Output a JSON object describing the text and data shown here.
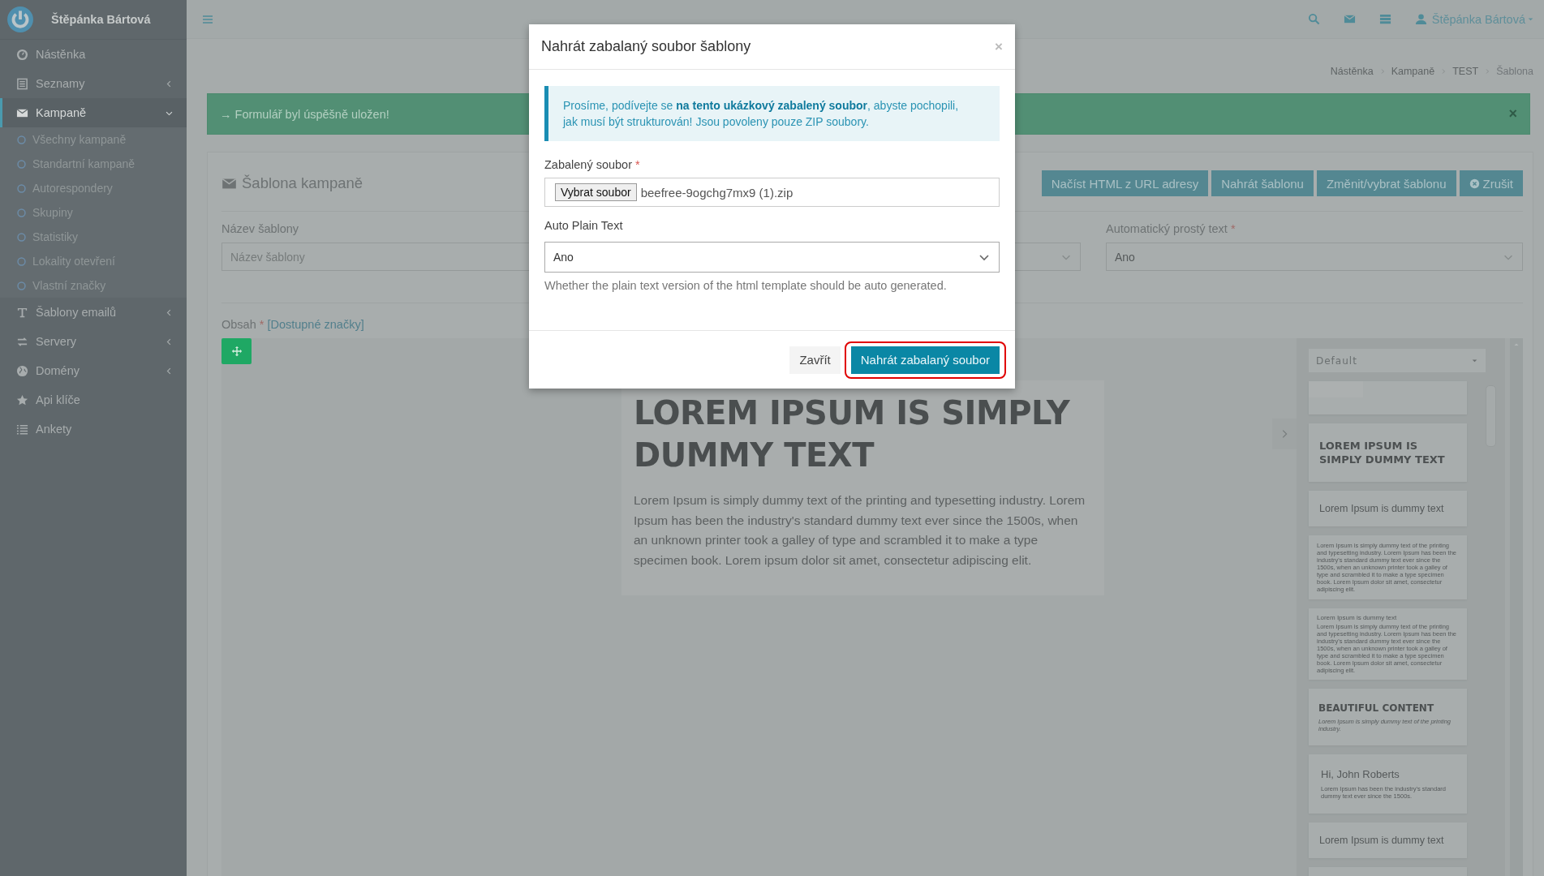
{
  "brand": {
    "name": "Štěpánka Bártová"
  },
  "sidebar": {
    "items": [
      {
        "label": "Nástěnka",
        "selected": false
      },
      {
        "label": "Seznamy",
        "expanded": false,
        "selected": false
      },
      {
        "label": "Kampaně",
        "expanded": true,
        "selected": true,
        "children": [
          {
            "label": "Všechny kampaně"
          },
          {
            "label": "Standartní kampaně"
          },
          {
            "label": "Autorespondery"
          },
          {
            "label": "Skupiny"
          },
          {
            "label": "Statistiky"
          },
          {
            "label": "Lokality otevření"
          },
          {
            "label": "Vlastní značky"
          }
        ]
      },
      {
        "label": "Šablony emailů",
        "expanded": false,
        "selected": false
      },
      {
        "label": "Servery",
        "expanded": false,
        "selected": false
      },
      {
        "label": "Domény",
        "expanded": false,
        "selected": false
      },
      {
        "label": "Api klíče",
        "selected": false
      },
      {
        "label": "Ankety",
        "selected": false
      }
    ]
  },
  "topbar": {
    "user": "Štěpánka Bártová"
  },
  "breadcrumb": [
    {
      "label": "Nástěnka",
      "current": false
    },
    {
      "label": "Kampaně",
      "current": false
    },
    {
      "label": "TEST",
      "current": false
    },
    {
      "label": "Šablona",
      "current": true
    }
  ],
  "alert": {
    "text": "→ Formulář byl úspěšně uložen!",
    "close": "×"
  },
  "card": {
    "title": "Šablona kampaně",
    "buttons": [
      {
        "label": "Načíst HTML z URL adresy",
        "kind": "action"
      },
      {
        "label": "Nahrát šablonu",
        "kind": "action"
      },
      {
        "label": "Změnit/vybrat šablonu",
        "kind": "action"
      },
      {
        "label": "Zrušit",
        "kind": "cancel"
      }
    ],
    "fields": [
      {
        "kind": "input",
        "label": "Název šablony",
        "placeholder": "Název šablony"
      },
      {
        "kind": "select"
      },
      {
        "kind": "select",
        "label": "Automatický prostý text",
        "required_mark": "*",
        "value": "Ano"
      }
    ],
    "content": {
      "label": "Obsah",
      "required_mark": "*",
      "link": "[Dostupné značky]"
    },
    "editor": {
      "heading": "LOREM IPSUM IS SIMPLY DUMMY TEXT",
      "paragraph": "Lorem Ipsum is simply dummy text of the printing and typesetting industry. Lorem Ipsum has been the industry's standard dummy text ever since the 1500s, when an unknown printer took a galley of type and scrambled it to make a type specimen book. Lorem ipsum dolor sit amet, consectetur adipiscing elit.",
      "panel": {
        "dropdown": "Default",
        "blocks": [
          {
            "kind": "image"
          },
          {
            "kind": "heading",
            "title": "LOREM IPSUM IS SIMPLY DUMMY TEXT"
          },
          {
            "kind": "subtitle",
            "title": "Lorem Ipsum is dummy text"
          },
          {
            "kind": "paragraph",
            "text": "Lorem Ipsum is simply dummy text of the printing and typesetting industry. Lorem Ipsum has been the industry's standard dummy text ever since the 1500s, when an unknown printer took a galley of type and scrambled it to make a type specimen book. Lorem Ipsum dolor sit amet, consectetur adipiscing elit."
          },
          {
            "kind": "title_paragraph",
            "title": "Lorem Ipsum is dummy text",
            "text": "Lorem Ipsum is simply dummy text of the printing and typesetting industry. Lorem Ipsum has been the industry's standard dummy text ever since the 1500s, when an unknown printer took a galley of type and scrambled it to make a type specimen book. Lorem Ipsum dolor sit amet, consectetur adipiscing elit."
          },
          {
            "kind": "caption",
            "title": "BEAUTIFUL CONTENT",
            "text": "Lorem Ipsum is simply dummy text of the printing industry."
          },
          {
            "kind": "greeting",
            "title": "Hi, John Roberts",
            "text": "Lorem Ipsum has been the industry's standard dummy text ever since the 1500s."
          },
          {
            "kind": "subtitle",
            "title": "Lorem Ipsum is dummy text"
          },
          {
            "kind": "blank"
          }
        ]
      }
    }
  },
  "modal": {
    "title": "Nahrát zabalaný soubor šablony",
    "close": "×",
    "info": "Prosíme, podívejte se **na tento ukázkový zabalený soubor**, abyste pochopili, jak musí být strukturován! Jsou povoleny pouze ZIP soubory.",
    "file_field": {
      "label": "Zabalený soubor",
      "required_mark": "*",
      "button": "Vybrat soubor",
      "value": "beefree-9ogchg7mx9 (1).zip"
    },
    "select_field": {
      "label": "Auto Plain Text",
      "value": "Ano",
      "help": "Whether the plain text version of the html template should be auto generated."
    },
    "buttons": [
      {
        "label": "Zavřít",
        "kind": "default",
        "highlighted": false
      },
      {
        "label": "Nahrát zabalaný soubor",
        "kind": "primary",
        "highlighted": true
      }
    ]
  }
}
